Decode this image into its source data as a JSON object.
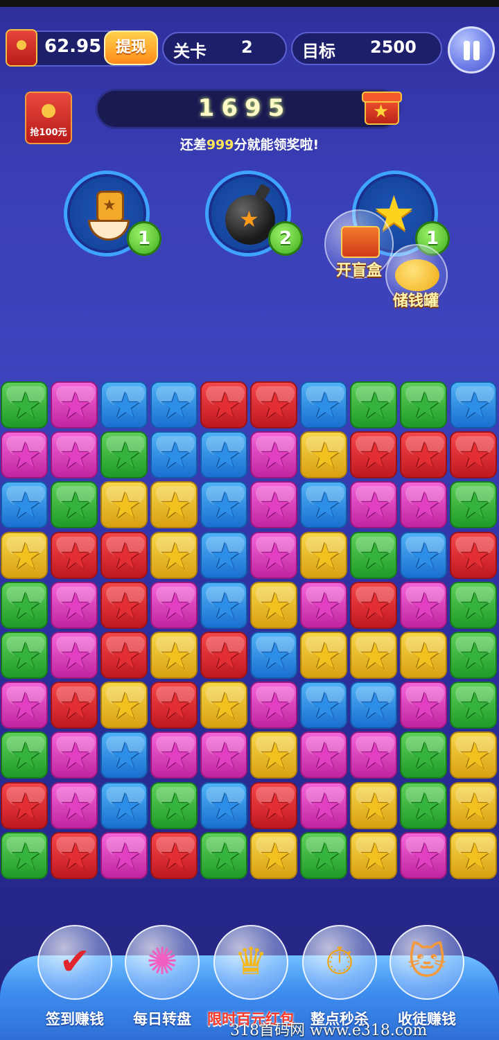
{
  "hud": {
    "money": "62.95",
    "withdraw_label": "提现",
    "level_label": "关卡",
    "level_value": "2",
    "target_label": "目标",
    "target_value": "2500"
  },
  "grab_redpack_label": "抢100元",
  "score": {
    "value": "1695",
    "hint_prefix": "还差",
    "hint_number": "999",
    "hint_suffix": "分就能领奖啦!"
  },
  "boosters": [
    {
      "name": "brush",
      "count": "1"
    },
    {
      "name": "bomb",
      "count": "2"
    },
    {
      "name": "winged-star",
      "count": "1"
    }
  ],
  "floating": {
    "blind_box_label": "开盲盒",
    "piggy_label": "储钱罐"
  },
  "board": {
    "rows": [
      [
        "green",
        "pink",
        "blue",
        "blue",
        "red",
        "red",
        "blue",
        "green",
        "green",
        "blue"
      ],
      [
        "pink",
        "pink",
        "green",
        "blue",
        "blue",
        "pink",
        "yellow",
        "red",
        "red",
        "red"
      ],
      [
        "blue",
        "green",
        "yellow",
        "yellow",
        "blue",
        "pink",
        "blue",
        "pink",
        "pink",
        "green"
      ],
      [
        "yellow",
        "red",
        "red",
        "yellow",
        "blue",
        "pink",
        "yellow",
        "green",
        "blue",
        "red"
      ],
      [
        "green",
        "pink",
        "red",
        "pink",
        "blue",
        "yellow",
        "pink",
        "red",
        "pink",
        "green"
      ],
      [
        "green",
        "pink",
        "red",
        "yellow",
        "red",
        "blue",
        "yellow",
        "yellow",
        "yellow",
        "green"
      ],
      [
        "pink",
        "red",
        "yellow",
        "red",
        "yellow",
        "pink",
        "blue",
        "blue",
        "pink",
        "green"
      ],
      [
        "green",
        "pink",
        "blue",
        "pink",
        "pink",
        "yellow",
        "pink",
        "pink",
        "green",
        "yellow"
      ],
      [
        "red",
        "pink",
        "blue",
        "green",
        "blue",
        "red",
        "pink",
        "yellow",
        "green",
        "yellow"
      ],
      [
        "green",
        "red",
        "pink",
        "red",
        "green",
        "yellow",
        "green",
        "yellow",
        "pink",
        "yellow"
      ]
    ],
    "colors": {
      "green": "#1f9a27",
      "pink": "#c0249f",
      "blue": "#1a6fd0",
      "red": "#c01820",
      "yellow": "#d9a012"
    }
  },
  "nav": [
    {
      "label": "签到赚钱",
      "icon": "checkin-notebook-icon",
      "hot": false
    },
    {
      "label": "每日转盘",
      "icon": "wheel-icon",
      "hot": false
    },
    {
      "label": "限时百元红包",
      "icon": "crown-icon",
      "hot": true
    },
    {
      "label": "整点秒杀",
      "icon": "stopwatch-icon",
      "hot": false
    },
    {
      "label": "收徒赚钱",
      "icon": "cats-icon",
      "hot": false
    }
  ],
  "watermark": "318首码网 www.e318.com"
}
